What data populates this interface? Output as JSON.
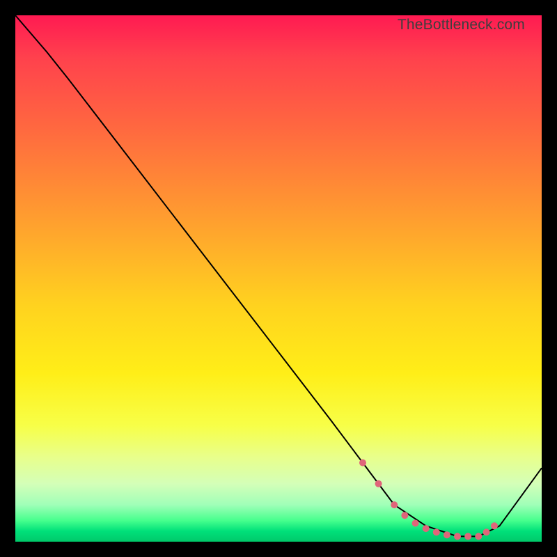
{
  "watermark": "TheBottleneck.com",
  "chart_data": {
    "type": "line",
    "title": "",
    "xlabel": "",
    "ylabel": "",
    "xlim": [
      0,
      100
    ],
    "ylim": [
      0,
      100
    ],
    "series": [
      {
        "name": "curve",
        "color": "#000000",
        "x": [
          0,
          6,
          10,
          20,
          30,
          40,
          50,
          60,
          66,
          72,
          78,
          84,
          88,
          92,
          100
        ],
        "y": [
          100,
          93,
          88,
          75,
          62,
          49,
          36,
          23,
          15,
          7,
          3,
          1,
          1,
          3,
          14
        ]
      }
    ],
    "markers": {
      "name": "bottom-dots",
      "color": "#e0657a",
      "radius": 5,
      "x": [
        66,
        69,
        72,
        74,
        76,
        78,
        80,
        82,
        84,
        86,
        88,
        89.5,
        91
      ],
      "y": [
        15,
        11,
        7,
        5,
        3.5,
        2.5,
        1.8,
        1.3,
        1,
        1,
        1,
        1.8,
        3
      ]
    }
  }
}
